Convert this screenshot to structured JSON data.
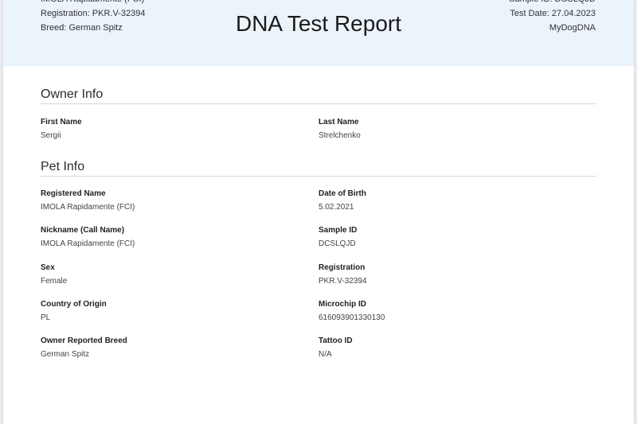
{
  "header": {
    "registered_name": "IMOLA Rapidamente (FCI)",
    "registration": "Registration: PKR.V-32394",
    "breed": "Breed: German Spitz",
    "sample_id": "Sample ID: DCSLQJD",
    "test_date": "Test Date: 27.04.2023",
    "lab": "MyDogDNA",
    "title": "DNA Test Report"
  },
  "owner_info": {
    "title": "Owner Info",
    "fields": [
      {
        "label": "First Name",
        "value": "Sergii"
      },
      {
        "label": "Last Name",
        "value": "Strelchenko"
      }
    ]
  },
  "pet_info": {
    "title": "Pet Info",
    "fields": [
      {
        "label": "Registered Name",
        "value": "IMOLA Rapidamente (FCI)"
      },
      {
        "label": "Date of Birth",
        "value": "5.02.2021"
      },
      {
        "label": "Nickname (Call Name)",
        "value": "IMOLA Rapidamente (FCI)"
      },
      {
        "label": "Sample ID",
        "value": "DCSLQJD"
      },
      {
        "label": "Sex",
        "value": "Female"
      },
      {
        "label": "Registration",
        "value": "PKR.V-32394"
      },
      {
        "label": "Country of Origin",
        "value": "PL"
      },
      {
        "label": "Microchip ID",
        "value": "616093901330130"
      },
      {
        "label": "Owner Reported Breed",
        "value": "German Spitz"
      },
      {
        "label": "Tattoo ID",
        "value": "N/A"
      }
    ]
  }
}
